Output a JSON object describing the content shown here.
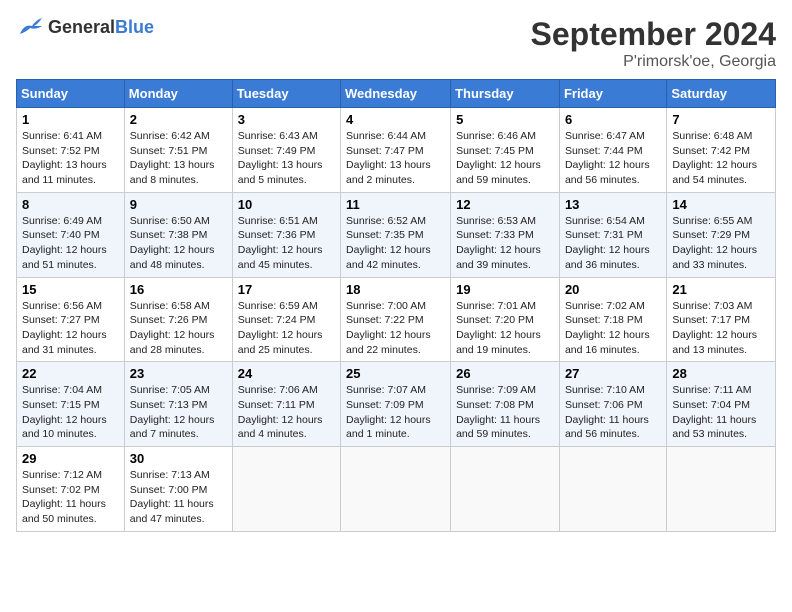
{
  "header": {
    "logo_general": "General",
    "logo_blue": "Blue",
    "month_title": "September 2024",
    "location": "P'rimorsk'oe, Georgia"
  },
  "weekdays": [
    "Sunday",
    "Monday",
    "Tuesday",
    "Wednesday",
    "Thursday",
    "Friday",
    "Saturday"
  ],
  "weeks": [
    [
      {
        "day": "1",
        "lines": [
          "Sunrise: 6:41 AM",
          "Sunset: 7:52 PM",
          "Daylight: 13 hours",
          "and 11 minutes."
        ]
      },
      {
        "day": "2",
        "lines": [
          "Sunrise: 6:42 AM",
          "Sunset: 7:51 PM",
          "Daylight: 13 hours",
          "and 8 minutes."
        ]
      },
      {
        "day": "3",
        "lines": [
          "Sunrise: 6:43 AM",
          "Sunset: 7:49 PM",
          "Daylight: 13 hours",
          "and 5 minutes."
        ]
      },
      {
        "day": "4",
        "lines": [
          "Sunrise: 6:44 AM",
          "Sunset: 7:47 PM",
          "Daylight: 13 hours",
          "and 2 minutes."
        ]
      },
      {
        "day": "5",
        "lines": [
          "Sunrise: 6:46 AM",
          "Sunset: 7:45 PM",
          "Daylight: 12 hours",
          "and 59 minutes."
        ]
      },
      {
        "day": "6",
        "lines": [
          "Sunrise: 6:47 AM",
          "Sunset: 7:44 PM",
          "Daylight: 12 hours",
          "and 56 minutes."
        ]
      },
      {
        "day": "7",
        "lines": [
          "Sunrise: 6:48 AM",
          "Sunset: 7:42 PM",
          "Daylight: 12 hours",
          "and 54 minutes."
        ]
      }
    ],
    [
      {
        "day": "8",
        "lines": [
          "Sunrise: 6:49 AM",
          "Sunset: 7:40 PM",
          "Daylight: 12 hours",
          "and 51 minutes."
        ]
      },
      {
        "day": "9",
        "lines": [
          "Sunrise: 6:50 AM",
          "Sunset: 7:38 PM",
          "Daylight: 12 hours",
          "and 48 minutes."
        ]
      },
      {
        "day": "10",
        "lines": [
          "Sunrise: 6:51 AM",
          "Sunset: 7:36 PM",
          "Daylight: 12 hours",
          "and 45 minutes."
        ]
      },
      {
        "day": "11",
        "lines": [
          "Sunrise: 6:52 AM",
          "Sunset: 7:35 PM",
          "Daylight: 12 hours",
          "and 42 minutes."
        ]
      },
      {
        "day": "12",
        "lines": [
          "Sunrise: 6:53 AM",
          "Sunset: 7:33 PM",
          "Daylight: 12 hours",
          "and 39 minutes."
        ]
      },
      {
        "day": "13",
        "lines": [
          "Sunrise: 6:54 AM",
          "Sunset: 7:31 PM",
          "Daylight: 12 hours",
          "and 36 minutes."
        ]
      },
      {
        "day": "14",
        "lines": [
          "Sunrise: 6:55 AM",
          "Sunset: 7:29 PM",
          "Daylight: 12 hours",
          "and 33 minutes."
        ]
      }
    ],
    [
      {
        "day": "15",
        "lines": [
          "Sunrise: 6:56 AM",
          "Sunset: 7:27 PM",
          "Daylight: 12 hours",
          "and 31 minutes."
        ]
      },
      {
        "day": "16",
        "lines": [
          "Sunrise: 6:58 AM",
          "Sunset: 7:26 PM",
          "Daylight: 12 hours",
          "and 28 minutes."
        ]
      },
      {
        "day": "17",
        "lines": [
          "Sunrise: 6:59 AM",
          "Sunset: 7:24 PM",
          "Daylight: 12 hours",
          "and 25 minutes."
        ]
      },
      {
        "day": "18",
        "lines": [
          "Sunrise: 7:00 AM",
          "Sunset: 7:22 PM",
          "Daylight: 12 hours",
          "and 22 minutes."
        ]
      },
      {
        "day": "19",
        "lines": [
          "Sunrise: 7:01 AM",
          "Sunset: 7:20 PM",
          "Daylight: 12 hours",
          "and 19 minutes."
        ]
      },
      {
        "day": "20",
        "lines": [
          "Sunrise: 7:02 AM",
          "Sunset: 7:18 PM",
          "Daylight: 12 hours",
          "and 16 minutes."
        ]
      },
      {
        "day": "21",
        "lines": [
          "Sunrise: 7:03 AM",
          "Sunset: 7:17 PM",
          "Daylight: 12 hours",
          "and 13 minutes."
        ]
      }
    ],
    [
      {
        "day": "22",
        "lines": [
          "Sunrise: 7:04 AM",
          "Sunset: 7:15 PM",
          "Daylight: 12 hours",
          "and 10 minutes."
        ]
      },
      {
        "day": "23",
        "lines": [
          "Sunrise: 7:05 AM",
          "Sunset: 7:13 PM",
          "Daylight: 12 hours",
          "and 7 minutes."
        ]
      },
      {
        "day": "24",
        "lines": [
          "Sunrise: 7:06 AM",
          "Sunset: 7:11 PM",
          "Daylight: 12 hours",
          "and 4 minutes."
        ]
      },
      {
        "day": "25",
        "lines": [
          "Sunrise: 7:07 AM",
          "Sunset: 7:09 PM",
          "Daylight: 12 hours",
          "and 1 minute."
        ]
      },
      {
        "day": "26",
        "lines": [
          "Sunrise: 7:09 AM",
          "Sunset: 7:08 PM",
          "Daylight: 11 hours",
          "and 59 minutes."
        ]
      },
      {
        "day": "27",
        "lines": [
          "Sunrise: 7:10 AM",
          "Sunset: 7:06 PM",
          "Daylight: 11 hours",
          "and 56 minutes."
        ]
      },
      {
        "day": "28",
        "lines": [
          "Sunrise: 7:11 AM",
          "Sunset: 7:04 PM",
          "Daylight: 11 hours",
          "and 53 minutes."
        ]
      }
    ],
    [
      {
        "day": "29",
        "lines": [
          "Sunrise: 7:12 AM",
          "Sunset: 7:02 PM",
          "Daylight: 11 hours",
          "and 50 minutes."
        ]
      },
      {
        "day": "30",
        "lines": [
          "Sunrise: 7:13 AM",
          "Sunset: 7:00 PM",
          "Daylight: 11 hours",
          "and 47 minutes."
        ]
      },
      null,
      null,
      null,
      null,
      null
    ]
  ]
}
